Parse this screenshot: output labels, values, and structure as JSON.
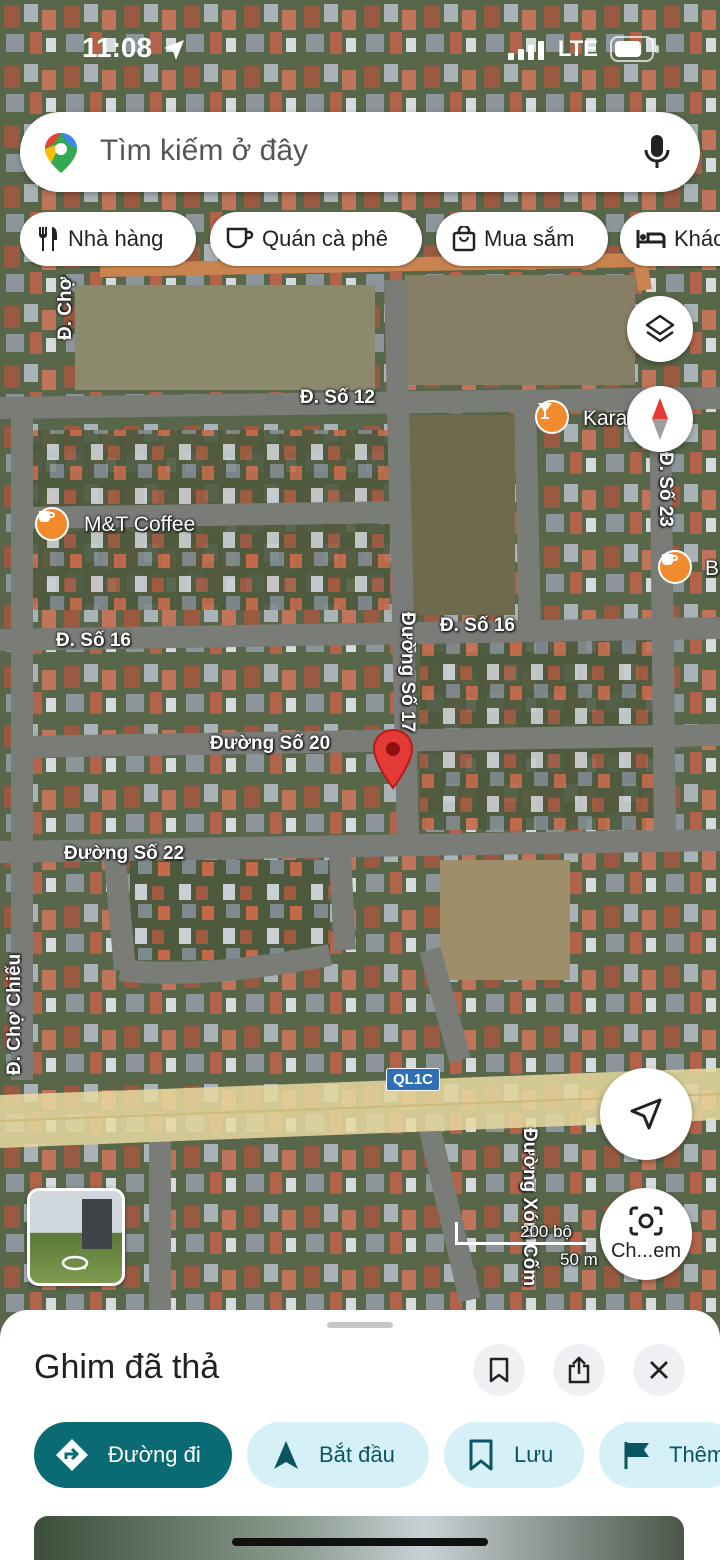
{
  "status_bar": {
    "time": "11:08",
    "network": "LTE"
  },
  "search": {
    "placeholder": "Tìm kiếm ở đây"
  },
  "chips": [
    {
      "label": "Nhà hàng",
      "icon": "restaurant-icon"
    },
    {
      "label": "Quán cà phê",
      "icon": "coffee-icon"
    },
    {
      "label": "Mua sắm",
      "icon": "shopping-bag-icon"
    },
    {
      "label": "Khác",
      "icon": "hotel-bed-icon"
    }
  ],
  "map": {
    "roads": {
      "cho_top": "Đ. Chợ",
      "so12": "Đ. Số 12",
      "so16_left": "Đ. Số 16",
      "so16_right": "Đ. Số 16",
      "so17": "Đường Số 17",
      "so20": "Đường Số 20",
      "so22": "Đường Số 22",
      "so23": "Đ. Số 23",
      "cho_chieu": "Đ. Chợ Chiếu",
      "xom_com": "Đường Xóm Cốm",
      "ql1c": "QL1C"
    },
    "pois": {
      "coffee": "M&T Coffee",
      "karaoke": "Karaoke ng",
      "right_b": "B"
    },
    "scale": {
      "top": "200 bộ",
      "bottom": "50 m"
    },
    "colors": {
      "pin": "#e53935",
      "poi": "#f28b2e",
      "highway": "#e7d9a0",
      "shield": "#2f6fb5"
    }
  },
  "fabs": {
    "layers": "layers-icon",
    "compass": "compass-icon",
    "navigate": "navigate-arrow-icon",
    "camera_label": "Ch...em"
  },
  "sheet": {
    "title": "Ghim đã thả",
    "buttons": {
      "directions": "Đường đi",
      "start": "Bắt đầu",
      "save": "Lưu",
      "more": "Thêm"
    },
    "colors": {
      "primary": "#0b6b75",
      "secondary": "#d6f0f7"
    }
  }
}
